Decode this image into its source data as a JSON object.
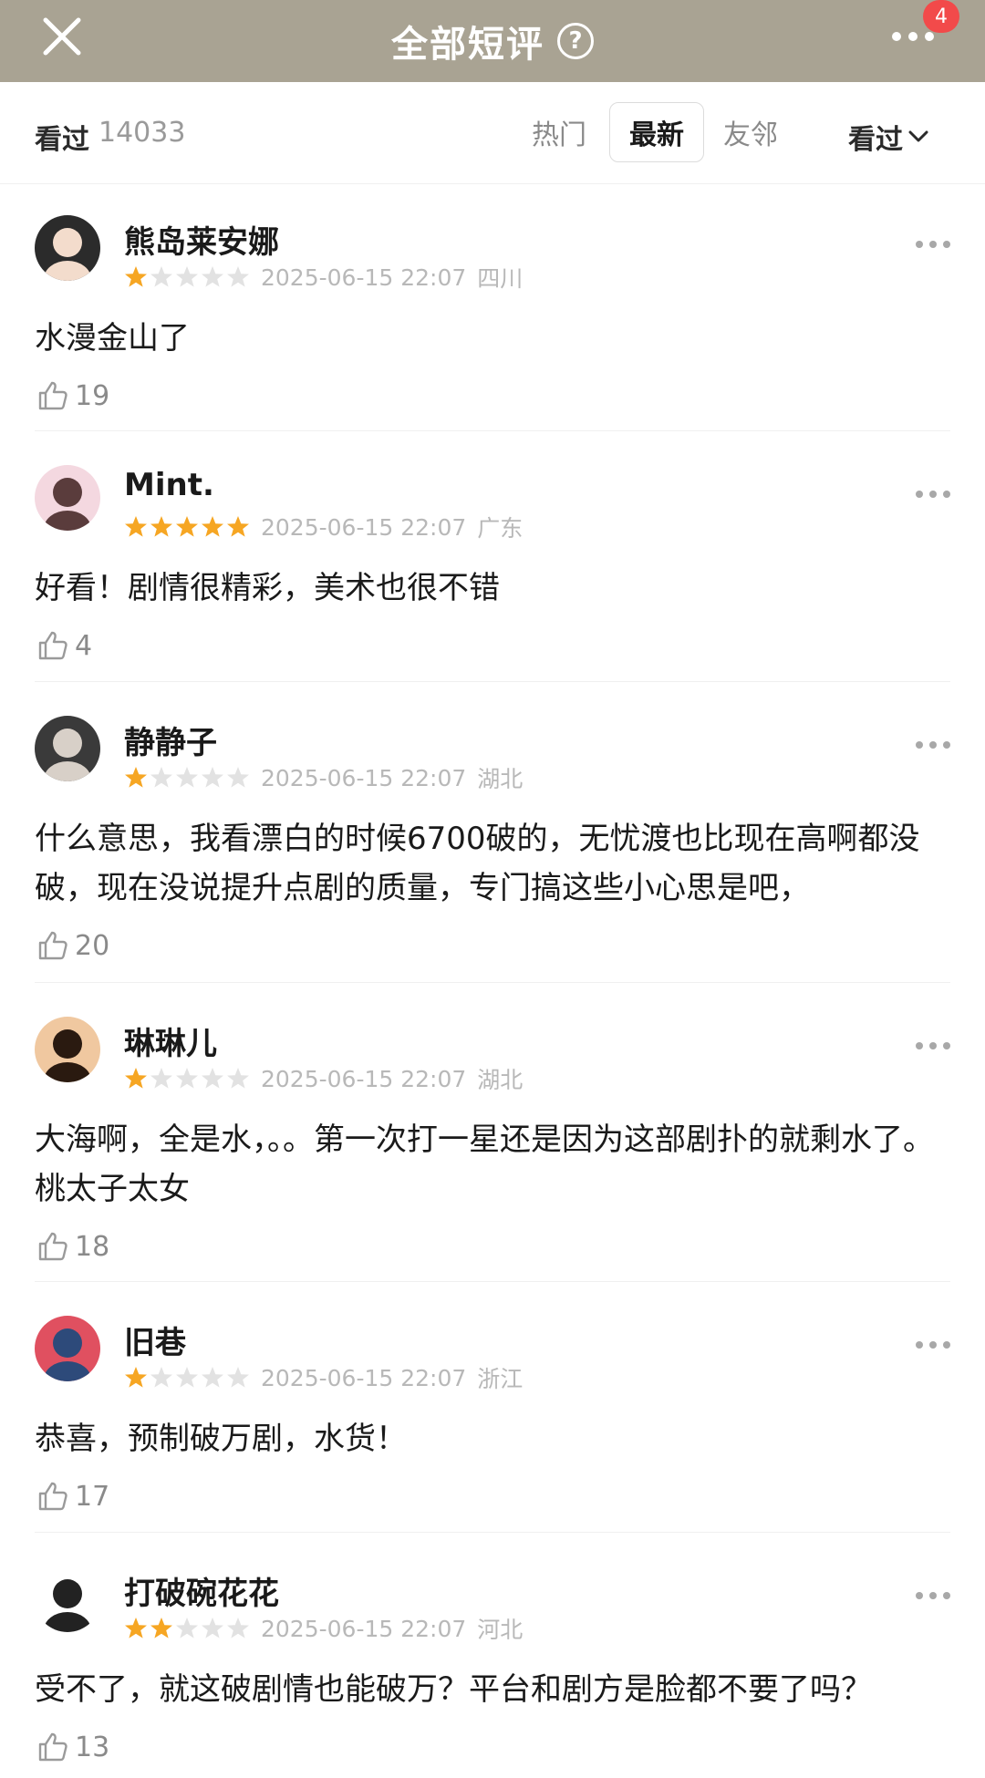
{
  "header": {
    "title": "全部短评",
    "help_icon": "?",
    "badge": "4"
  },
  "filters": {
    "seen_label": "看过",
    "seen_count": "14033",
    "tabs": [
      "热门",
      "最新",
      "友邻"
    ],
    "active_tab": "最新",
    "dropdown": "看过"
  },
  "colors": {
    "header_bg": "#a9a393",
    "star_on": "#f6a623",
    "star_off": "#e2e2e2",
    "badge": "#f24a4a"
  },
  "reviews": [
    {
      "name": "熊岛莱安娜",
      "rating": 1,
      "time": "2025-06-15 22:07",
      "region": "四川",
      "text": "水漫金山了",
      "likes": "19"
    },
    {
      "name": "Mint.",
      "rating": 5,
      "time": "2025-06-15 22:07",
      "region": "广东",
      "text": "好看！剧情很精彩，美术也很不错",
      "likes": "4"
    },
    {
      "name": "静静子",
      "rating": 1,
      "time": "2025-06-15 22:07",
      "region": "湖北",
      "text": "什么意思，我看漂白的时候6700破的，无忧渡也比现在高啊都没破，现在没说提升点剧的质量，专门搞这些小心思是吧，",
      "likes": "20"
    },
    {
      "name": "琳琳儿",
      "rating": 1,
      "time": "2025-06-15 22:07",
      "region": "湖北",
      "text": "大海啊，全是水，。。第一次打一星还是因为这部剧扑的就剩水了。桃太子太女",
      "likes": "18"
    },
    {
      "name": "旧巷",
      "rating": 1,
      "time": "2025-06-15 22:07",
      "region": "浙江",
      "text": "恭喜，预制破万剧，水货！",
      "likes": "17"
    },
    {
      "name": "打破碗花花",
      "rating": 2,
      "time": "2025-06-15 22:07",
      "region": "河北",
      "text": "受不了，就这破剧情也能破万？平台和剧方是脸都不要了吗？",
      "likes": "13"
    }
  ]
}
